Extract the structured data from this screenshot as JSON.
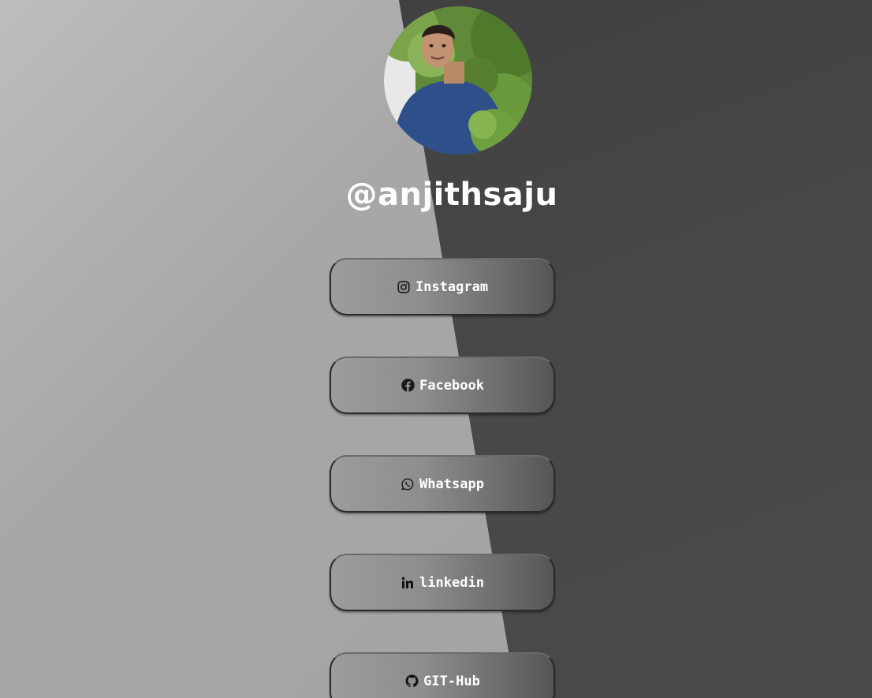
{
  "profile": {
    "username": "@anjithsaju",
    "avatar_icon": "profile-photo"
  },
  "links": [
    {
      "label": "Instagram",
      "icon": "instagram-icon"
    },
    {
      "label": "Facebook",
      "icon": "facebook-icon"
    },
    {
      "label": "Whatsapp",
      "icon": "whatsapp-icon"
    },
    {
      "label": "linkedin",
      "icon": "linkedin-icon"
    },
    {
      "label": "GIT-Hub",
      "icon": "github-icon"
    }
  ],
  "colors": {
    "background_light": "#a7a7a7",
    "background_dark": "#474747",
    "text": "#ffffff",
    "icon": "#1a1a1a"
  }
}
